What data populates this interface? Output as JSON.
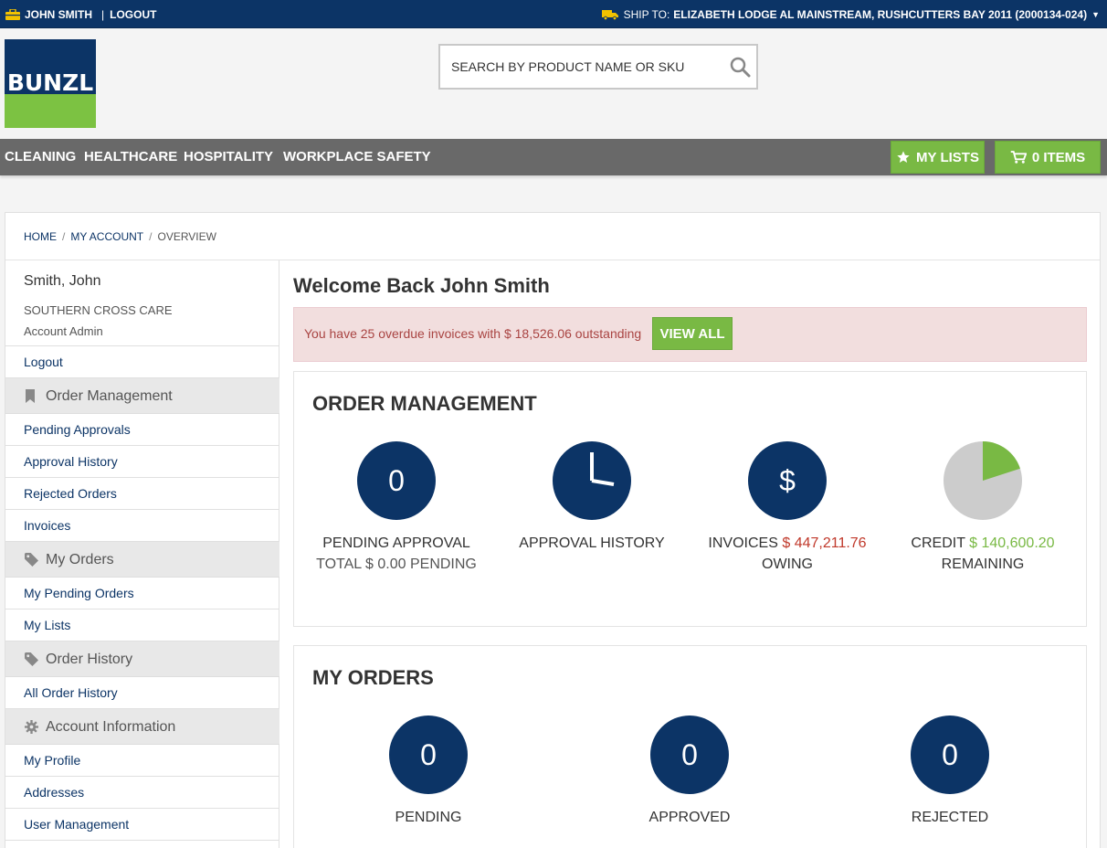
{
  "topbar": {
    "user_name": "JOHN SMITH",
    "separator": "|",
    "logout": "LOGOUT",
    "ship_to_label": "SHIP TO:",
    "ship_to_address": "ELIZABETH LODGE AL MAINSTREAM, RUSHCUTTERS BAY 2011 (2000134-024)"
  },
  "logo": {
    "text": "BUNZL"
  },
  "search": {
    "placeholder": "SEARCH BY PRODUCT NAME OR SKU"
  },
  "nav": {
    "items": [
      "CLEANING",
      "HEALTHCARE",
      "HOSPITALITY",
      "WORKPLACE SAFETY"
    ],
    "my_lists": "MY LISTS",
    "cart": "0 ITEMS"
  },
  "breadcrumb": {
    "home": "HOME",
    "account": "MY ACCOUNT",
    "current": "OVERVIEW",
    "sep": "/"
  },
  "sidebar": {
    "name": "Smith, John",
    "org": "SOUTHERN CROSS CARE",
    "role": "Account Admin",
    "logout": "Logout",
    "order_management": {
      "heading": "Order Management",
      "links": [
        "Pending Approvals",
        "Approval History",
        "Rejected Orders",
        "Invoices"
      ]
    },
    "my_orders": {
      "heading": "My Orders",
      "links": [
        "My Pending Orders",
        "My Lists"
      ]
    },
    "order_history": {
      "heading": "Order History",
      "links": [
        "All Order History"
      ]
    },
    "account_information": {
      "heading": "Account Information",
      "links": [
        "My Profile",
        "Addresses",
        "User Management"
      ]
    }
  },
  "welcome": "Welcome Back John Smith",
  "alert": {
    "message": "You have 25 overdue invoices with $ 18,526.06 outstanding",
    "button": "VIEW ALL"
  },
  "order_management": {
    "title": "ORDER MANAGEMENT",
    "pending": {
      "count": "0",
      "label": "PENDING APPROVAL",
      "sub": "TOTAL $ 0.00 PENDING"
    },
    "history": {
      "label": "APPROVAL HISTORY"
    },
    "invoices": {
      "symbol": "$",
      "label": "INVOICES",
      "amount": "$ 447,211.76",
      "sub": "OWING"
    },
    "credit": {
      "label": "CREDIT",
      "amount": "$ 140,600.20",
      "sub": "REMAINING",
      "remaining_fraction": 0.2
    }
  },
  "my_orders": {
    "title": "MY ORDERS",
    "pending": {
      "count": "0",
      "label": "PENDING"
    },
    "approved": {
      "count": "0",
      "label": "APPROVED"
    },
    "rejected": {
      "count": "0",
      "label": "REJECTED"
    }
  },
  "colors": {
    "navy": "#0c3466",
    "green": "#79b944",
    "nav_gray": "#696969",
    "alert_bg": "#f2dede"
  }
}
